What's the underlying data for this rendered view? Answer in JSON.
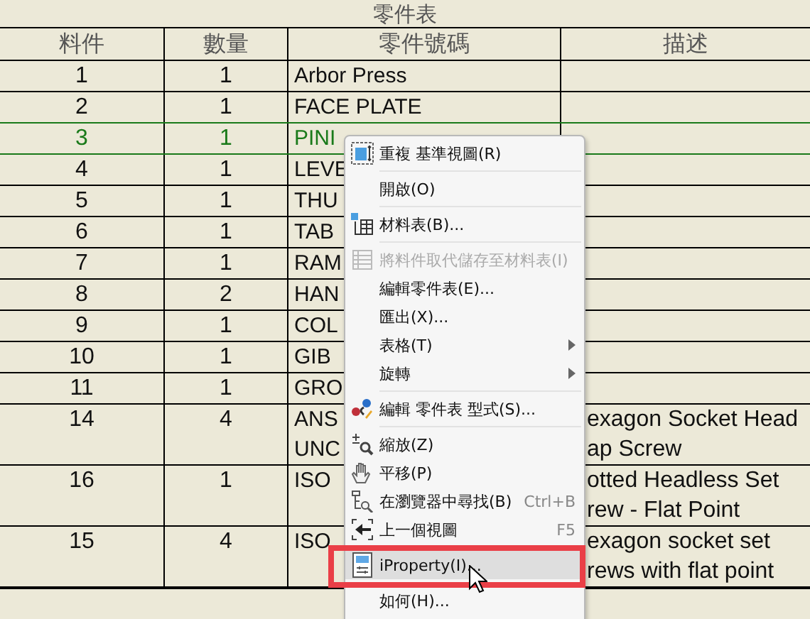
{
  "table": {
    "title": "零件表",
    "columns": [
      "料件",
      "數量",
      "零件號碼",
      "描述"
    ],
    "rows": [
      {
        "item": "1",
        "qty": "1",
        "part_number": [
          "Arbor Press"
        ],
        "description": [],
        "selected": false
      },
      {
        "item": "2",
        "qty": "1",
        "part_number": [
          "FACE PLATE"
        ],
        "description": [],
        "selected": false
      },
      {
        "item": "3",
        "qty": "1",
        "part_number": [
          "PINI"
        ],
        "description": [],
        "selected": true
      },
      {
        "item": "4",
        "qty": "1",
        "part_number": [
          "LEVE"
        ],
        "description": [],
        "selected": false
      },
      {
        "item": "5",
        "qty": "1",
        "part_number": [
          "THU"
        ],
        "description": [],
        "selected": false
      },
      {
        "item": "6",
        "qty": "1",
        "part_number": [
          "TAB"
        ],
        "description": [],
        "selected": false
      },
      {
        "item": "7",
        "qty": "1",
        "part_number": [
          "RAM"
        ],
        "description": [],
        "selected": false
      },
      {
        "item": "8",
        "qty": "2",
        "part_number": [
          "HAN"
        ],
        "description": [],
        "selected": false
      },
      {
        "item": "9",
        "qty": "1",
        "part_number": [
          "COL"
        ],
        "description": [],
        "selected": false
      },
      {
        "item": "10",
        "qty": "1",
        "part_number": [
          "GIB"
        ],
        "description": [],
        "selected": false
      },
      {
        "item": "11",
        "qty": "1",
        "part_number": [
          "GRO"
        ],
        "description": [],
        "selected": false
      },
      {
        "item": "14",
        "qty": "4",
        "part_number": [
          "ANS",
          "UNC"
        ],
        "description": [
          "exagon Socket Head",
          "ap Screw"
        ],
        "selected": false
      },
      {
        "item": "16",
        "qty": "1",
        "part_number": [
          "ISO"
        ],
        "description": [
          "otted Headless Set",
          "rew - Flat Point"
        ],
        "selected": false
      },
      {
        "item": "15",
        "qty": "4",
        "part_number": [
          "ISO"
        ],
        "description": [
          "exagon socket set",
          "rews with flat point"
        ],
        "selected": false
      }
    ]
  },
  "context_menu": {
    "items": [
      {
        "kind": "command",
        "label": "重複 基準視圖(R)",
        "disabled": false,
        "submenu": false,
        "selected": false
      },
      {
        "kind": "separator"
      },
      {
        "kind": "command",
        "label": "開啟(O)",
        "disabled": false,
        "submenu": false,
        "selected": false
      },
      {
        "kind": "separator"
      },
      {
        "kind": "command",
        "label": "材料表(B)...",
        "disabled": false,
        "submenu": false,
        "selected": false
      },
      {
        "kind": "separator"
      },
      {
        "kind": "command",
        "label": "將料件取代儲存至材料表(I)",
        "disabled": true,
        "submenu": false,
        "selected": false
      },
      {
        "kind": "command",
        "label": "編輯零件表(E)...",
        "disabled": false,
        "submenu": false,
        "selected": false
      },
      {
        "kind": "command",
        "label": "匯出(X)...",
        "disabled": false,
        "submenu": false,
        "selected": false
      },
      {
        "kind": "command",
        "label": "表格(T)",
        "disabled": false,
        "submenu": true,
        "selected": false
      },
      {
        "kind": "command",
        "label": "旋轉",
        "disabled": false,
        "submenu": true,
        "selected": false
      },
      {
        "kind": "separator"
      },
      {
        "kind": "command",
        "label": "編輯 零件表 型式(S)...",
        "disabled": false,
        "submenu": false,
        "selected": false
      },
      {
        "kind": "separator"
      },
      {
        "kind": "command",
        "label": "縮放(Z)",
        "disabled": false,
        "submenu": false,
        "selected": false
      },
      {
        "kind": "command",
        "label": "平移(P)",
        "disabled": false,
        "submenu": false,
        "selected": false
      },
      {
        "kind": "command",
        "label": "在瀏覽器中尋找(B)",
        "shortcut": "Ctrl+B",
        "disabled": false,
        "submenu": false,
        "selected": false
      },
      {
        "kind": "command",
        "label": "上一個視圖",
        "shortcut": "F5",
        "disabled": false,
        "submenu": false,
        "selected": false
      },
      {
        "kind": "separator"
      },
      {
        "kind": "command",
        "label": "iProperty(I)...",
        "disabled": false,
        "submenu": false,
        "selected": true
      },
      {
        "kind": "separator"
      },
      {
        "kind": "command",
        "label": "如何(H)...",
        "disabled": false,
        "submenu": false,
        "selected": false
      }
    ]
  }
}
